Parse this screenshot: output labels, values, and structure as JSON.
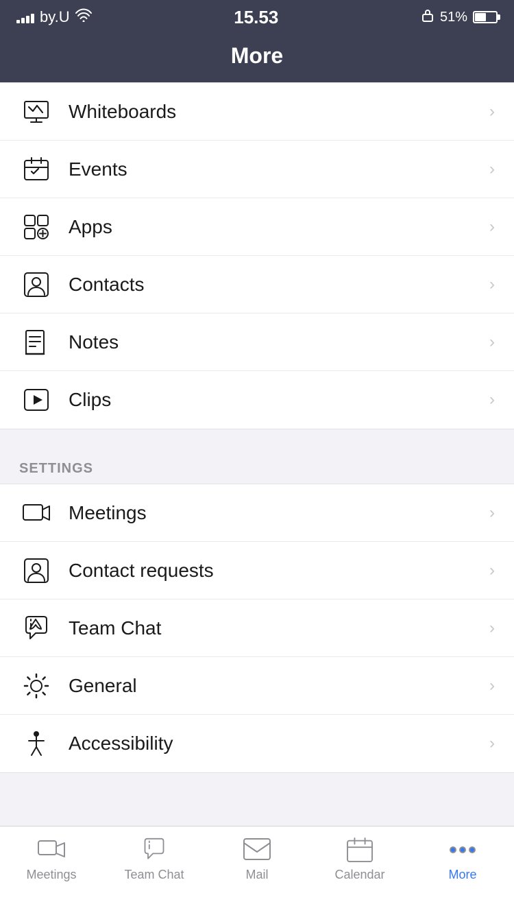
{
  "statusBar": {
    "carrier": "by.U",
    "time": "15.53",
    "battery": "51%",
    "lock_icon": "🔒"
  },
  "header": {
    "title": "More"
  },
  "sections": [
    {
      "id": "tools",
      "label": null,
      "items": [
        {
          "id": "whiteboards",
          "label": "Whiteboards",
          "icon": "whiteboard-icon",
          "partial": true
        },
        {
          "id": "events",
          "label": "Events",
          "icon": "events-icon"
        },
        {
          "id": "apps",
          "label": "Apps",
          "icon": "apps-icon"
        },
        {
          "id": "contacts",
          "label": "Contacts",
          "icon": "contacts-icon"
        },
        {
          "id": "notes",
          "label": "Notes",
          "icon": "notes-icon"
        },
        {
          "id": "clips",
          "label": "Clips",
          "icon": "clips-icon"
        }
      ]
    },
    {
      "id": "settings",
      "label": "SETTINGS",
      "items": [
        {
          "id": "meetings",
          "label": "Meetings",
          "icon": "meetings-icon"
        },
        {
          "id": "contact-requests",
          "label": "Contact requests",
          "icon": "contact-requests-icon"
        },
        {
          "id": "team-chat-settings",
          "label": "Team Chat",
          "icon": "team-chat-settings-icon"
        },
        {
          "id": "general",
          "label": "General",
          "icon": "general-icon"
        },
        {
          "id": "accessibility",
          "label": "Accessibility",
          "icon": "accessibility-icon"
        }
      ]
    }
  ],
  "bottomNav": {
    "items": [
      {
        "id": "meetings",
        "label": "Meetings",
        "active": false
      },
      {
        "id": "team-chat",
        "label": "Team Chat",
        "active": false
      },
      {
        "id": "mail",
        "label": "Mail",
        "active": false
      },
      {
        "id": "calendar",
        "label": "Calendar",
        "active": false
      },
      {
        "id": "more",
        "label": "More",
        "active": true
      }
    ]
  }
}
